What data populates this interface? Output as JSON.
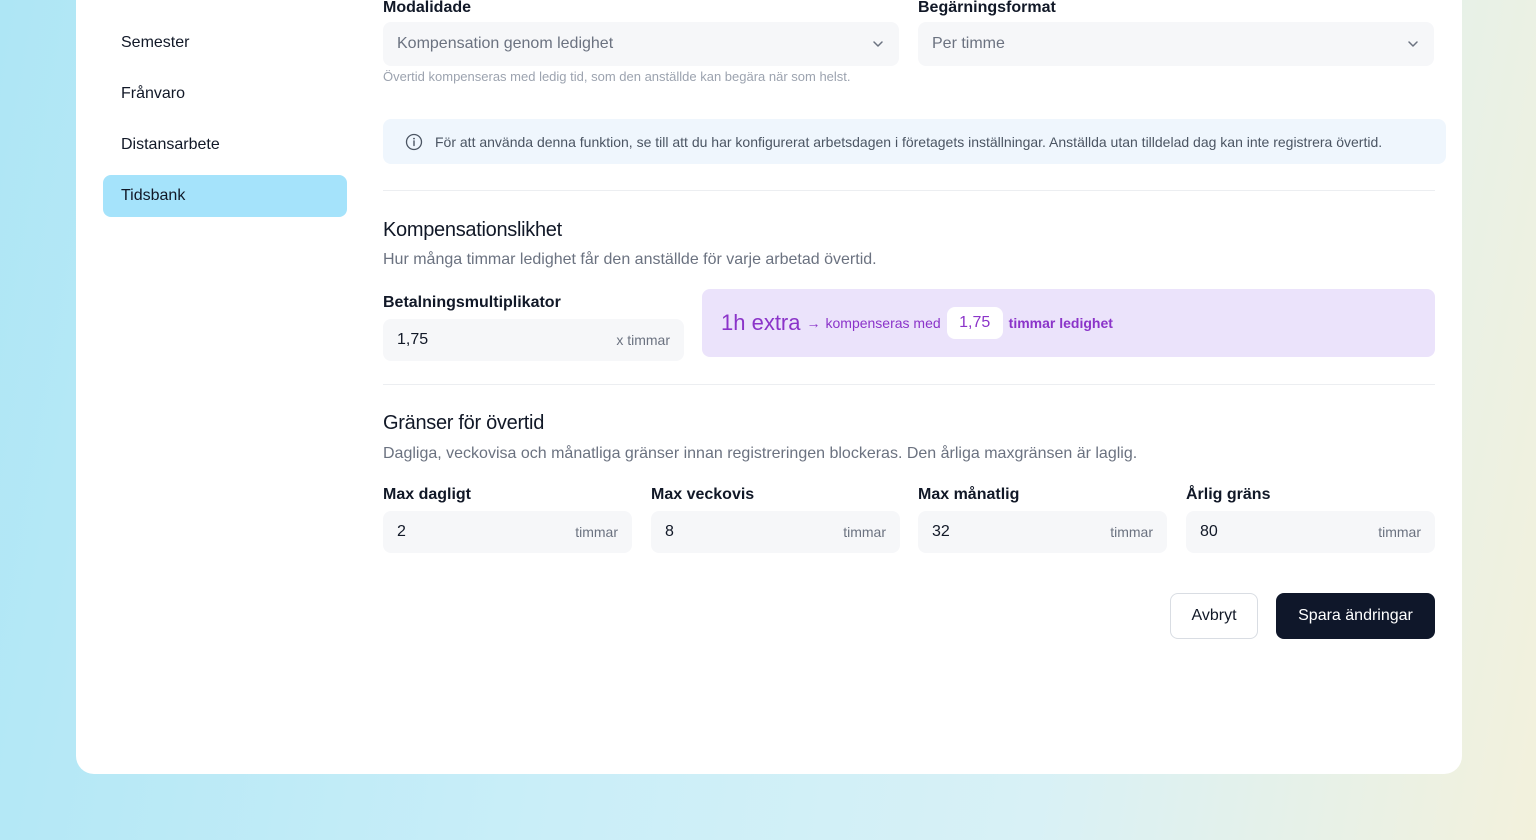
{
  "sidebar": {
    "items": [
      {
        "label": "Semester"
      },
      {
        "label": "Frånvaro"
      },
      {
        "label": "Distansarbete"
      },
      {
        "label": "Tidsbank",
        "active": true
      }
    ]
  },
  "modality": {
    "label": "Modalidade",
    "value": "Kompensation genom ledighet",
    "hint": "Övertid kompenseras med ledig tid, som den anställde kan begära när som helst."
  },
  "request_format": {
    "label": "Begärningsformat",
    "value": "Per timme"
  },
  "alert": {
    "icon": "info-icon",
    "text": "För att använda denna funktion, se till att du har konfigurerat arbetsdagen i företagets inställningar. Anställda utan tilldelad dag kan inte registrera övertid."
  },
  "compensation": {
    "title": "Kompensationslikhet",
    "subtitle": "Hur många timmar ledighet får den anställde för varje arbetad övertid.",
    "multiplier_label": "Betalningsmultiplikator",
    "multiplier_value": "1,75",
    "multiplier_unit": "x timmar",
    "preview": {
      "lead": "1h extra",
      "arrow": "→",
      "middle": "kompenseras med",
      "value": "1,75",
      "trail": "timmar ledighet"
    }
  },
  "limits": {
    "title": "Gränser för övertid",
    "subtitle": "Dagliga, veckovisa och månatliga gränser innan registreringen blockeras. Den årliga maxgränsen är laglig.",
    "fields": [
      {
        "label": "Max dagligt",
        "value": "2",
        "unit": "timmar"
      },
      {
        "label": "Max veckovis",
        "value": "8",
        "unit": "timmar"
      },
      {
        "label": "Max månatlig",
        "value": "32",
        "unit": "timmar"
      },
      {
        "label": "Årlig gräns",
        "value": "80",
        "unit": "timmar"
      }
    ]
  },
  "actions": {
    "cancel": "Avbryt",
    "save": "Spara ändringar"
  },
  "colors": {
    "active_nav": "#a5e3fb",
    "preview_bg": "#ebe3fb",
    "preview_text": "#8b34c9",
    "primary_button": "#0f172a"
  }
}
